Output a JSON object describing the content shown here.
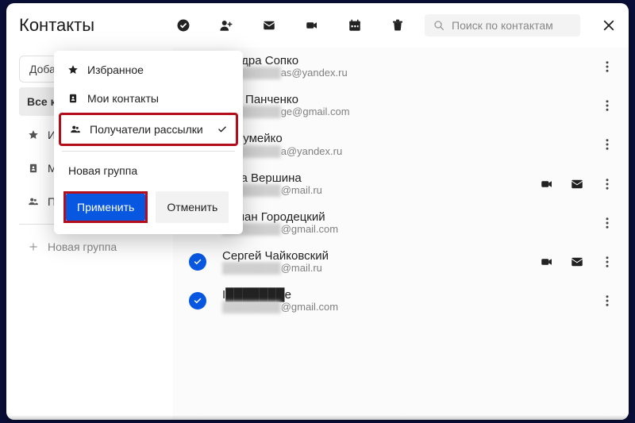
{
  "header": {
    "title": "Контакты",
    "search_placeholder": "Поиск по контактам"
  },
  "sidebar": {
    "add_label": "Доба",
    "items": [
      {
        "label": "Все к",
        "selected": true
      },
      {
        "label": "И"
      },
      {
        "label": "М"
      },
      {
        "label": "П"
      }
    ],
    "new_group": "Новая группа"
  },
  "popup": {
    "fav": "Избранное",
    "my": "Мои контакты",
    "recipients": "Получатели рассылки",
    "new_group": "Новая группа",
    "apply": "Применить",
    "cancel": "Отменить"
  },
  "contacts": [
    {
      "name": "сандра Сопко",
      "email_visible": "as@yandex.ru",
      "has_video": false,
      "has_mail": false
    },
    {
      "name": "пий Панченко",
      "email_visible": "ge@gmail.com",
      "has_video": false,
      "has_mail": false
    },
    {
      "name": "а Шумейко",
      "email_visible": "a@yandex.ru",
      "has_video": false,
      "has_mail": false
    },
    {
      "name": "тина Вершина",
      "email_visible": "@mail.ru",
      "has_video": true,
      "has_mail": true
    },
    {
      "name": "Роман Городецкий",
      "email_visible": "@gmail.com",
      "has_video": false,
      "has_mail": false
    },
    {
      "name": "Сергей Чайковский",
      "email_visible": "@mail.ru",
      "has_video": true,
      "has_mail": true
    },
    {
      "name": "I",
      "email_visible": "@gmail.com",
      "has_video": false,
      "has_mail": false,
      "blur_name": true
    }
  ]
}
